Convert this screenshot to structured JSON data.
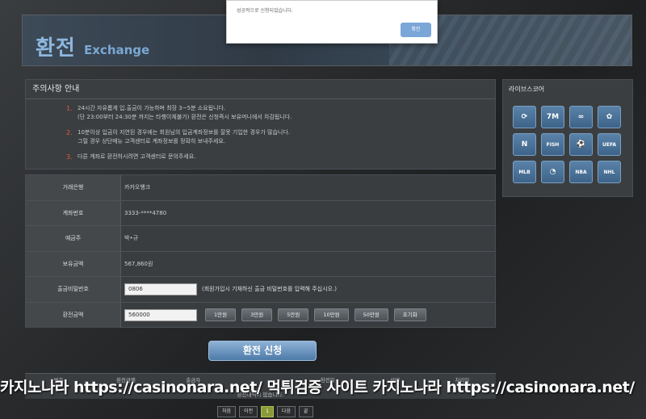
{
  "header": {
    "title_ko": "환전",
    "title_en": "Exchange"
  },
  "notice": {
    "title": "주의사항 안내",
    "items": [
      {
        "num": "1.",
        "text": "24시간 자유롭게 입.출금이 가능하며 최장 3~5분 소요됩니다.\n(단 23:00부터 24:30분 까지는 타행이체불가) 환전은 신청즉시 보유머니에서 차감됩니다."
      },
      {
        "num": "2.",
        "text": "10분이상 입금이 지연된 경우에는 회원님의 입금계좌정보를 잘못 기입한 경우가 많습니다.\n그럴 경우 상단메뉴 고객센터로 계좌정보를 정확히 보내주세요."
      },
      {
        "num": "3.",
        "text": "다른 계좌로 환전하시려면 고객센터로 문의주세요."
      }
    ]
  },
  "form": {
    "bank_label": "거래은행",
    "bank_value": "카카오뱅크",
    "account_label": "계좌번호",
    "account_value": "3333-****4780",
    "holder_label": "예금주",
    "holder_value": "박•규",
    "balance_label": "보유금액",
    "balance_value": "567,860원",
    "pw_label": "출금비밀번호",
    "pw_value": "0806",
    "pw_hint": "(회원가입시 기재하신 출금 비밀번호를 입력해 주십시오.)",
    "amount_label": "환전금액",
    "amount_value": "560000",
    "amount_buttons": [
      "1만원",
      "3만원",
      "5만원",
      "10만원",
      "50만원",
      "초기화"
    ]
  },
  "submit_label": "환전 신청",
  "history": {
    "columns": [
      "번호",
      "환전금액",
      "출금자",
      "",
      "환전일",
      "상태",
      "처리일"
    ],
    "empty": "환전내역이 없습니다."
  },
  "pager": [
    "처음",
    "이전",
    "1",
    "다음",
    "끝"
  ],
  "live": {
    "title": "라이브스코어",
    "tiles": [
      "⟳",
      "7M",
      "∞",
      "✿",
      "N",
      "FISH",
      "⚽",
      "UEFA",
      "MLB",
      "◔",
      "NBA",
      "NHL"
    ]
  },
  "watermark": "카지노나라 https://casinonara.net/     먹튀검증 사이트 카지노나라 https://casinonara.net/",
  "dialog": {
    "message": "성공적으로 신청되었습니다.",
    "ok": "확인"
  }
}
